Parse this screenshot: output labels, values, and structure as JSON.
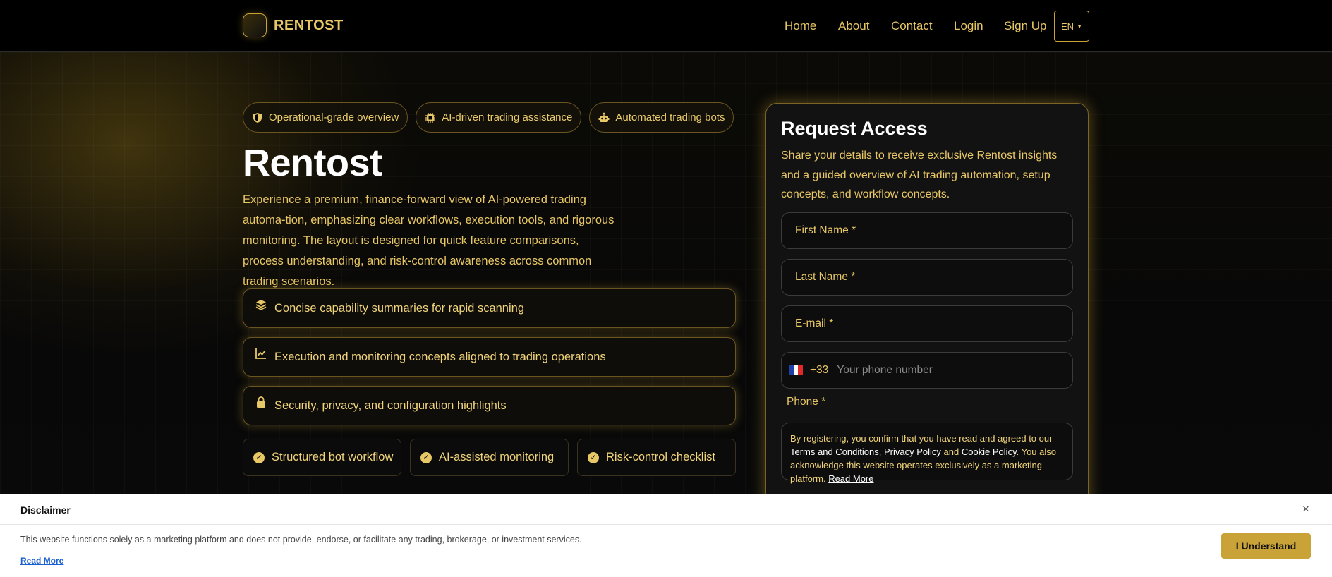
{
  "brand": {
    "name": "RENTOST"
  },
  "nav": {
    "items": [
      "Home",
      "About",
      "Contact",
      "Login",
      "Sign Up"
    ],
    "lang": "EN"
  },
  "hero": {
    "pills": [
      {
        "label": "Operational-grade overview",
        "icon": "shield-icon"
      },
      {
        "label": "AI-driven trading assistance",
        "icon": "chip-icon"
      },
      {
        "label": "Automated trading bots",
        "icon": "robot-icon"
      }
    ],
    "title": "Rentost",
    "lead": "Experience a premium, finance-forward view of AI-powered trading automa-tion, emphasizing clear workflows, execution tools, and rigorous monitoring. The layout is designed for quick feature comparisons, process understanding, and risk-control awareness across common trading scenarios.",
    "features": [
      {
        "label": "Concise capability summaries for rapid scanning",
        "icon": "layers-icon"
      },
      {
        "label": "Execution and monitoring concepts aligned to trading operations",
        "icon": "chart-line-icon"
      },
      {
        "label": "Security, privacy, and configuration highlights",
        "icon": "lock-icon"
      }
    ],
    "chips": [
      "Structured bot workflow",
      "AI-assisted monitoring",
      "Risk-control checklist"
    ]
  },
  "form": {
    "title": "Request Access",
    "subtitle": "Share your details to receive exclusive Rentost insights and a guided overview of AI trading automation, setup concepts, and workflow concepts.",
    "first_name": "First Name *",
    "last_name": "Last Name *",
    "email": "E-mail *",
    "phone_code": "+33",
    "phone_placeholder": "Your phone number",
    "phone_label": "Phone *",
    "consent": {
      "text1": "By registering, you confirm that you have read and agreed to our ",
      "terms": "Terms and Conditions",
      "comma": ", ",
      "privacy": "Privacy Policy",
      "and": " and ",
      "cookie": "Cookie Policy",
      "text2": ". You also acknowledge this website operates exclusively as a marketing platform. ",
      "read_more": "Read More"
    }
  },
  "disclaimer": {
    "title": "Disclaimer",
    "close": "×",
    "text": "This website functions solely as a marketing platform and does not provide, endorse, or facilitate any trading, brokerage, or investment services.",
    "link": "Read More",
    "button": "I Understand"
  },
  "colors": {
    "accent": "#e8c766",
    "accent_dark": "#c9a338",
    "background": "#050505"
  }
}
